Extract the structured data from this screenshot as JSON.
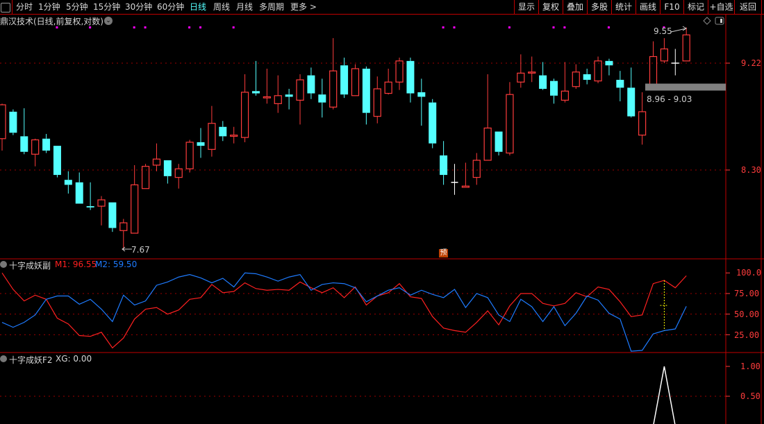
{
  "toolbar": {
    "periods": [
      "分时",
      "1分钟",
      "5分钟",
      "15分钟",
      "30分钟",
      "60分钟",
      "日线",
      "周线",
      "月线",
      "多周期",
      "更多 >"
    ],
    "active_period": "日线",
    "buttons": [
      "显示",
      "复权",
      "叠加",
      "多股",
      "统计",
      "画线",
      "F10",
      "标记",
      "+自选",
      "返回"
    ]
  },
  "main_panel": {
    "title": "鼎汉技术(日线,前复权,对数)",
    "axis_labels": [
      "9.22",
      "8.30"
    ],
    "high_label": "9.55",
    "low_label": "7.67",
    "range_label": "8.96 - 9.03",
    "forecast_badge": "预"
  },
  "indicator1": {
    "name": "十字成妖副",
    "m1_label": "M1: 96.55",
    "m2_label": "M2: 59.50",
    "axis_labels": [
      "100.0",
      "75.00",
      "50.00",
      "25.00"
    ]
  },
  "indicator2": {
    "name": "十字成妖F2",
    "xg_label": "XG: 0.00",
    "axis_labels": [
      "1.00",
      "0.50"
    ]
  },
  "colors": {
    "up": "#ff3c3c",
    "down": "#54ffff",
    "doji": "#ffffff",
    "m1": "#ff2020",
    "m2": "#1e7bff",
    "grid": "#a00000",
    "signal": "#ff00ff",
    "xg": "#ffffff",
    "cursor": "#ffff00"
  },
  "chart_data": {
    "type": "candlestick",
    "price_scale": "log",
    "candles_ohlc": [
      [
        8.56,
        8.86,
        8.46,
        8.85
      ],
      [
        8.79,
        8.81,
        8.59,
        8.61
      ],
      [
        8.58,
        8.82,
        8.43,
        8.45
      ],
      [
        8.43,
        8.56,
        8.33,
        8.55
      ],
      [
        8.56,
        8.6,
        8.44,
        8.46
      ],
      [
        8.5,
        8.5,
        8.24,
        8.26
      ],
      [
        8.22,
        8.29,
        8.11,
        8.18
      ],
      [
        8.2,
        8.28,
        8.03,
        8.03
      ],
      [
        8.01,
        8.2,
        7.98,
        8.0
      ],
      [
        8.01,
        8.09,
        7.86,
        8.06
      ],
      [
        8.04,
        8.04,
        7.81,
        7.84
      ],
      [
        7.82,
        7.91,
        7.67,
        7.88
      ],
      [
        7.8,
        8.34,
        7.8,
        8.18
      ],
      [
        8.15,
        8.35,
        8.15,
        8.33
      ],
      [
        8.34,
        8.52,
        8.29,
        8.39
      ],
      [
        8.38,
        8.38,
        8.19,
        8.25
      ],
      [
        8.24,
        8.35,
        8.15,
        8.31
      ],
      [
        8.31,
        8.55,
        8.28,
        8.53
      ],
      [
        8.53,
        8.65,
        8.4,
        8.5
      ],
      [
        8.47,
        8.84,
        8.41,
        8.69
      ],
      [
        8.66,
        8.71,
        8.54,
        8.58
      ],
      [
        8.58,
        8.66,
        8.52,
        8.59
      ],
      [
        8.57,
        9.12,
        8.53,
        8.96
      ],
      [
        8.97,
        9.24,
        8.93,
        8.95
      ],
      [
        8.91,
        9.17,
        8.86,
        8.92
      ],
      [
        8.86,
        9.11,
        8.78,
        8.93
      ],
      [
        8.94,
        8.99,
        8.81,
        8.92
      ],
      [
        8.89,
        9.12,
        8.68,
        9.07
      ],
      [
        9.11,
        9.18,
        8.9,
        8.95
      ],
      [
        8.94,
        9.08,
        8.74,
        8.87
      ],
      [
        8.83,
        9.45,
        8.81,
        9.15
      ],
      [
        9.2,
        9.27,
        8.91,
        8.94
      ],
      [
        8.93,
        9.21,
        8.93,
        9.17
      ],
      [
        9.17,
        9.19,
        8.68,
        8.78
      ],
      [
        8.75,
        9.1,
        8.69,
        8.99
      ],
      [
        8.95,
        9.17,
        8.94,
        9.05
      ],
      [
        9.05,
        9.27,
        8.98,
        9.24
      ],
      [
        9.24,
        9.27,
        8.87,
        8.95
      ],
      [
        8.96,
        9.08,
        8.67,
        8.92
      ],
      [
        8.87,
        8.9,
        8.48,
        8.52
      ],
      [
        8.42,
        8.54,
        8.18,
        8.26
      ],
      [
        8.2,
        8.35,
        8.1,
        8.2
      ],
      [
        8.16,
        8.36,
        8.16,
        8.17
      ],
      [
        8.24,
        8.44,
        8.18,
        8.38
      ],
      [
        8.38,
        9.12,
        8.38,
        8.65
      ],
      [
        8.62,
        8.62,
        8.42,
        8.45
      ],
      [
        8.44,
        9.05,
        8.42,
        8.94
      ],
      [
        9.05,
        9.3,
        9.0,
        9.13
      ],
      [
        9.13,
        9.28,
        9.05,
        9.14
      ],
      [
        9.11,
        9.23,
        8.98,
        8.99
      ],
      [
        9.06,
        9.08,
        8.86,
        8.93
      ],
      [
        8.89,
        9.23,
        8.87,
        8.97
      ],
      [
        9.01,
        9.21,
        8.99,
        9.14
      ],
      [
        9.12,
        9.17,
        9.03,
        9.07
      ],
      [
        9.06,
        9.28,
        9.04,
        9.24
      ],
      [
        9.24,
        9.26,
        9.11,
        9.2
      ],
      [
        9.07,
        9.15,
        8.88,
        9.0
      ],
      [
        9.0,
        9.18,
        8.74,
        8.75
      ],
      [
        8.59,
        8.96,
        8.51,
        8.79
      ],
      [
        9.03,
        9.42,
        9.03,
        9.28
      ],
      [
        9.24,
        9.45,
        9.22,
        9.35
      ],
      [
        9.22,
        9.35,
        9.11,
        9.22
      ],
      [
        9.24,
        9.55,
        9.24,
        9.48
      ]
    ],
    "signal_candle_indices": [
      5,
      8,
      12,
      13,
      17,
      18,
      21,
      40,
      41,
      46,
      50,
      51,
      55,
      60
    ],
    "gridlines": [
      9.22,
      8.3
    ],
    "range_band": [
      8.96,
      9.03
    ],
    "indicator1": {
      "ylim": [
        0,
        100
      ],
      "gridlines": [
        75,
        50,
        25
      ],
      "series": [
        {
          "name": "M1",
          "values": [
            100,
            80,
            66,
            73,
            68,
            45,
            38,
            24,
            23,
            28,
            9,
            21,
            44,
            56,
            58,
            50,
            55,
            68,
            70,
            86,
            76,
            77.5,
            88,
            81,
            79,
            80,
            79,
            89,
            82,
            76,
            82,
            70,
            83,
            61,
            72,
            76,
            87,
            71,
            69,
            47,
            33,
            30,
            28,
            40,
            54,
            37,
            60,
            75,
            75,
            63,
            60,
            63,
            76,
            71,
            83,
            80,
            65,
            47,
            49,
            87,
            91,
            82,
            96.55
          ]
        },
        {
          "name": "M2",
          "values": [
            40,
            34,
            40,
            49,
            68,
            72,
            72,
            62,
            68,
            56,
            41,
            73,
            61,
            66,
            85,
            89,
            95,
            98,
            94,
            88,
            93.5,
            83,
            100,
            99,
            95,
            90,
            95,
            98,
            79,
            86,
            88,
            87,
            82,
            65,
            72,
            79,
            82,
            73,
            79,
            74,
            70,
            80,
            58,
            75,
            70,
            49,
            41,
            68,
            59,
            41,
            59,
            36,
            51,
            72,
            67,
            51,
            44,
            5,
            6,
            26,
            30,
            32,
            59.5
          ]
        }
      ]
    },
    "indicator2": {
      "ylim": [
        0,
        1
      ],
      "gridlines": [
        0.5
      ],
      "series": [
        {
          "name": "XG",
          "values": [
            0,
            0,
            0,
            0,
            0,
            0,
            0,
            0,
            0,
            0,
            0,
            0,
            0,
            0,
            0,
            0,
            0,
            0,
            0,
            0,
            0,
            0,
            0,
            0,
            0,
            0,
            0,
            0,
            0,
            0,
            0,
            0,
            0,
            0,
            0,
            0,
            0,
            0,
            0,
            0,
            0,
            0,
            0,
            0,
            0,
            0,
            0,
            0,
            0,
            0,
            0,
            0,
            0,
            0,
            0,
            0,
            0,
            0,
            0,
            0,
            1,
            0,
            0
          ]
        }
      ]
    },
    "cursor_candle_index": 60
  }
}
